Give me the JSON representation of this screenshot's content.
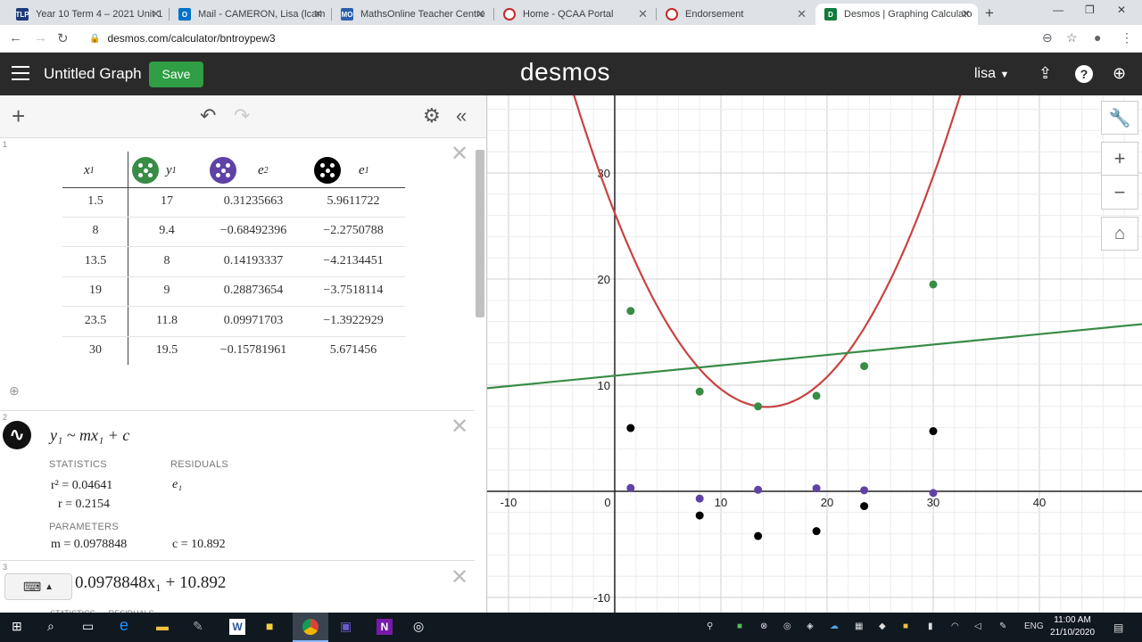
{
  "browser": {
    "tabs": [
      {
        "title": "Year 10 Term 4 – 2021 Unit 1",
        "icon": "tlp-icon",
        "color": "#1f3b7a"
      },
      {
        "title": "Mail - CAMERON, Lisa (lcam",
        "icon": "outlook-icon",
        "color": "#0072c6"
      },
      {
        "title": "MathsOnline Teacher Centre",
        "icon": "mathsonline-icon",
        "color": "#2b5fad"
      },
      {
        "title": "Home - QCAA Portal",
        "icon": "qcaa-icon",
        "color": "#c62828"
      },
      {
        "title": "Endorsement",
        "icon": "qcaa-icon",
        "color": "#c62828"
      },
      {
        "title": "Desmos | Graphing Calculato",
        "icon": "desmos-icon",
        "color": "#127a3c"
      }
    ],
    "url": "desmos.com/calculator/bntroypew3"
  },
  "header": {
    "graph_title": "Untitled Graph",
    "save_label": "Save",
    "logo": "desmos",
    "user": "lisa"
  },
  "table": {
    "headers": [
      {
        "var": "x",
        "sub": "1"
      },
      {
        "var": "y",
        "sub": "1"
      },
      {
        "var": "e",
        "sub": "2"
      },
      {
        "var": "e",
        "sub": "1"
      }
    ],
    "rows": [
      [
        "1.5",
        "17",
        "0.31235663",
        "5.9611722"
      ],
      [
        "8",
        "9.4",
        "−0.68492396",
        "−2.2750788"
      ],
      [
        "13.5",
        "8",
        "0.14193337",
        "−4.2134451"
      ],
      [
        "19",
        "9",
        "0.28873654",
        "−3.7518114"
      ],
      [
        "23.5",
        "11.8",
        "0.09971703",
        "−1.3922929"
      ],
      [
        "30",
        "19.5",
        "−0.15781961",
        "5.671456"
      ]
    ],
    "colors": {
      "y1": "#388c46",
      "e2": "#6042a6",
      "e1": "#000000"
    }
  },
  "regression": {
    "expression": "y₁ ~ mx₁ + c",
    "statistics_label": "STATISTICS",
    "residuals_label": "RESIDUALS",
    "parameters_label": "PARAMETERS",
    "r2": "r² = 0.04641",
    "r": "r = 0.2154",
    "residual_var": "e₁",
    "m": "m = 0.0978848",
    "c": "c = 10.892"
  },
  "expression3": "0.0978848x₁ + 10.892",
  "expression3_cut_labels": "STATISTICS      RESIDUALS",
  "expr_indices": [
    "1",
    "2",
    "3"
  ],
  "graph": {
    "x_ticks": [
      "-10",
      "0",
      "10",
      "20",
      "30",
      "40"
    ],
    "y_ticks": [
      "30",
      "20",
      "10",
      "-10"
    ],
    "parabola_color": "#c74440",
    "line_color": "#388c46"
  },
  "taskbar": {
    "time": "11:00 AM",
    "date": "21/10/2020",
    "lang": "ENG"
  }
}
